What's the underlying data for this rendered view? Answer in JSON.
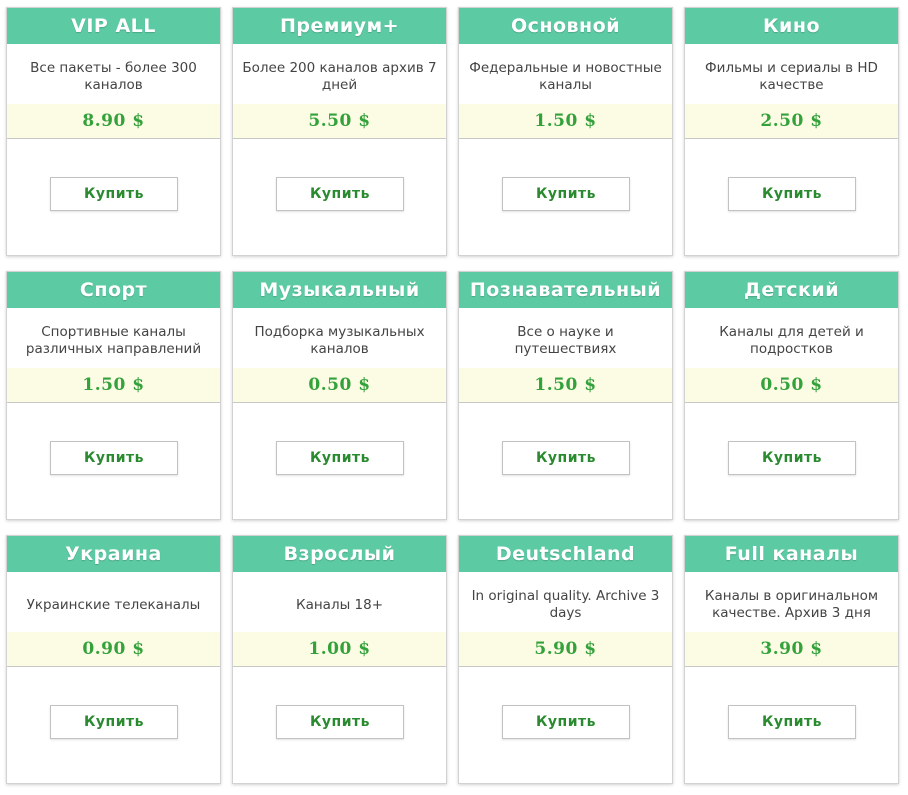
{
  "packages": [
    {
      "title": "VIP ALL",
      "description": "Все пакеты - более 300 каналов",
      "price": "8.90 $",
      "button": "Купить"
    },
    {
      "title": "Премиум+",
      "description": "Более 200 каналов архив 7 дней",
      "price": "5.50 $",
      "button": "Купить"
    },
    {
      "title": "Основной",
      "description": "Федеральные и новостные каналы",
      "price": "1.50 $",
      "button": "Купить"
    },
    {
      "title": "Кино",
      "description": "Фильмы и сериалы в HD качестве",
      "price": "2.50 $",
      "button": "Купить"
    },
    {
      "title": "Спорт",
      "description": "Спортивные каналы различных направлений",
      "price": "1.50 $",
      "button": "Купить"
    },
    {
      "title": "Музыкальный",
      "description": "Подборка музыкальных каналов",
      "price": "0.50 $",
      "button": "Купить"
    },
    {
      "title": "Познавательный",
      "description": "Все о науке и путешествиях",
      "price": "1.50 $",
      "button": "Купить"
    },
    {
      "title": "Детский",
      "description": "Каналы для детей и подростков",
      "price": "0.50 $",
      "button": "Купить"
    },
    {
      "title": "Украина",
      "description": "Украинские телеканалы",
      "price": "0.90 $",
      "button": "Купить"
    },
    {
      "title": "Взрослый",
      "description": "Каналы 18+",
      "price": "1.00 $",
      "button": "Купить"
    },
    {
      "title": "Deutschland",
      "description": "In original quality. Archive 3 days",
      "price": "5.90 $",
      "button": "Купить"
    },
    {
      "title": "Full каналы",
      "description": "Каналы в оригинальном качестве. Архив 3 дня",
      "price": "3.90 $",
      "button": "Купить"
    }
  ],
  "colors": {
    "header": "#5ccba3",
    "price_bg": "#fcfbe4",
    "price_text": "#33a23b",
    "button_text": "#2a8a2f"
  }
}
